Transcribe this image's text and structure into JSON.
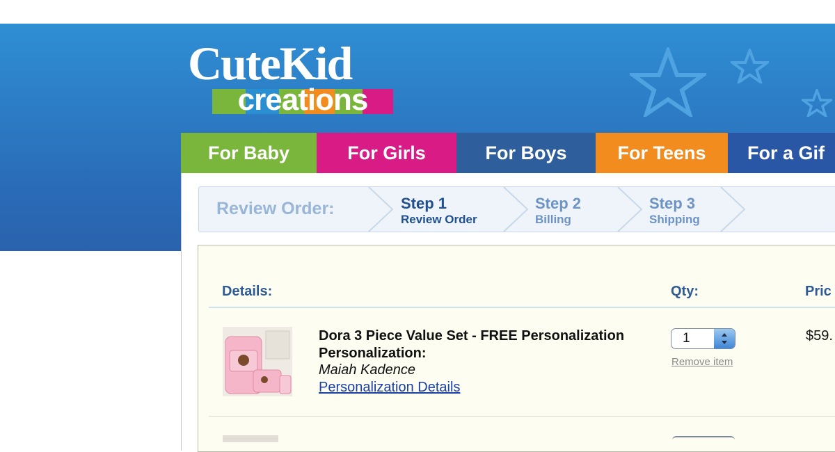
{
  "logo": {
    "line1": "CuteKid",
    "line2": "creations"
  },
  "colors": {
    "banner": "#2e86cc",
    "nav_baby": "#7ab63b",
    "nav_girls": "#d81b85",
    "nav_boys": "#2e5f9c",
    "nav_teens": "#f28c1e",
    "nav_gift": "#2a56a6",
    "step_active": "#1f4f8f",
    "step_inactive": "#6d93c4"
  },
  "nav": {
    "items": [
      {
        "label": "For Baby"
      },
      {
        "label": "For Girls"
      },
      {
        "label": "For Boys"
      },
      {
        "label": "For Teens"
      },
      {
        "label": "For a Gif"
      }
    ]
  },
  "steps": {
    "title": "Review Order:",
    "items": [
      {
        "num": "Step 1",
        "sub": "Review Order"
      },
      {
        "num": "Step 2",
        "sub": "Billing"
      },
      {
        "num": "Step 3",
        "sub": "Shipping"
      }
    ]
  },
  "cart": {
    "headers": {
      "details": "Details:",
      "qty": "Qty:",
      "price": "Pric"
    },
    "items": [
      {
        "title": "Dora 3 Piece Value Set - FREE Personalization",
        "personalization_label": "Personalization:",
        "personalization_name": "Maiah Kadence",
        "link": "Personalization Details",
        "qty": "1",
        "remove": "Remove item",
        "price": "$59."
      }
    ]
  },
  "icons": {
    "star": "star-icon",
    "stepper": "stepper-arrows-icon",
    "chevron": "chevron-right-icon"
  }
}
